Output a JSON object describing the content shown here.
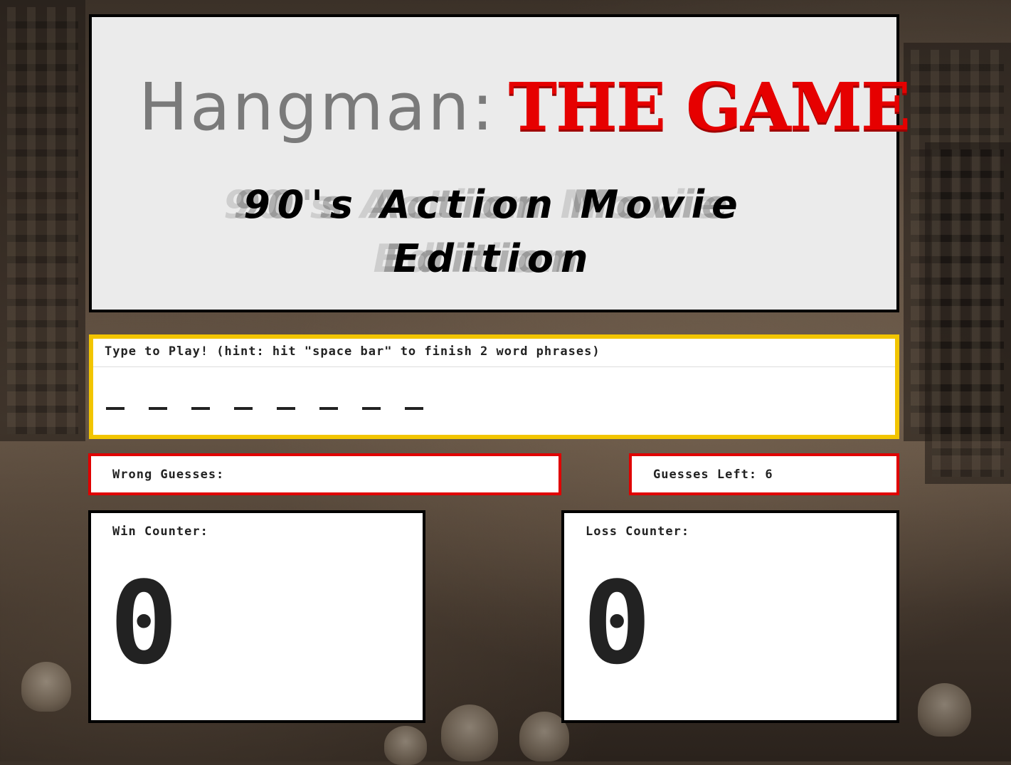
{
  "title": {
    "main": "Hangman:",
    "accent": "THE GAME",
    "subtitle_line1": "90's Action Movie",
    "subtitle_line2": "Edition"
  },
  "play": {
    "instructions": "Type to Play! (hint: hit \"space bar\" to finish 2 word phrases)",
    "blank_count": 8
  },
  "wrong_guesses": {
    "label": "Wrong Guesses:",
    "value": ""
  },
  "guesses_left": {
    "label": "Guesses Left:",
    "value": "6"
  },
  "win_counter": {
    "label": "Win Counter:",
    "value": "0"
  },
  "loss_counter": {
    "label": "Loss Counter:",
    "value": "0"
  },
  "colors": {
    "title_panel_bg": "#ebebeb",
    "accent_red": "#e60000",
    "play_border": "#f2c500",
    "stat_border": "#e00000"
  }
}
